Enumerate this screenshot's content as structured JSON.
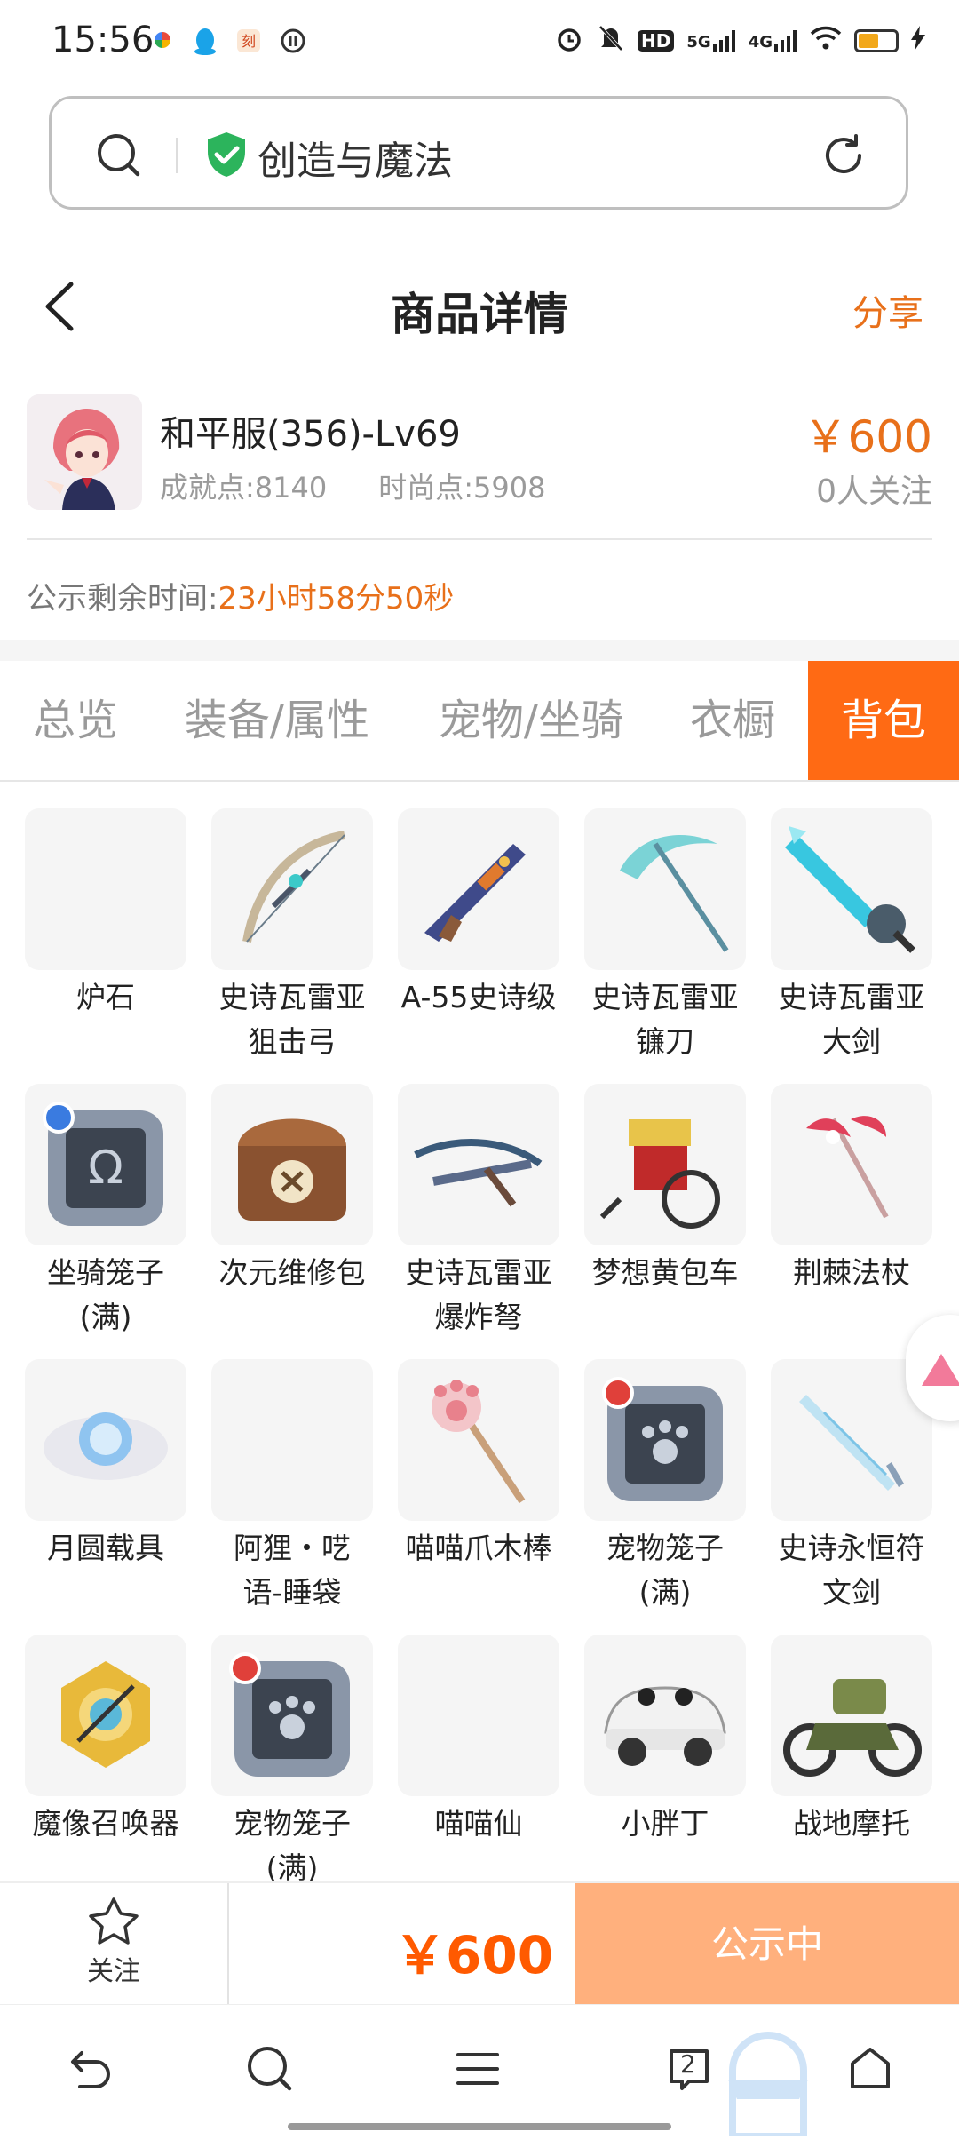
{
  "status_bar": {
    "time": "15:56",
    "signal_5g": "5G",
    "signal_4g": "4G",
    "hd": "HD"
  },
  "browser": {
    "query": "创造与魔法"
  },
  "header": {
    "title": "商品详情",
    "share": "分享"
  },
  "item": {
    "name": "和平服(356)-Lv69",
    "achievement": "成就点:8140",
    "fashion": "时尚点:5908",
    "price": "￥600",
    "watchers": "0人关注",
    "countdown_label": "公示剩余时间:",
    "countdown_value": "23小时58分50秒"
  },
  "tabs": [
    {
      "label": "总览"
    },
    {
      "label": "装备/属性"
    },
    {
      "label": "宠物/坐骑"
    },
    {
      "label": "衣橱"
    },
    {
      "label": "背包",
      "active": true
    }
  ],
  "inventory": [
    {
      "label": "炉石",
      "icon": "empty"
    },
    {
      "label": "史诗瓦雷亚狙击弓",
      "icon": "bow-icon"
    },
    {
      "label": "A-55史诗级",
      "icon": "rifle-icon"
    },
    {
      "label": "史诗瓦雷亚镰刀",
      "icon": "scythe-icon"
    },
    {
      "label": "史诗瓦雷亚大剑",
      "icon": "greatsword-icon"
    },
    {
      "label": "坐骑笼子(满)",
      "icon": "mount-cage-icon"
    },
    {
      "label": "次元维修包",
      "icon": "repair-bag-icon"
    },
    {
      "label": "史诗瓦雷亚爆炸弩",
      "icon": "crossbow-icon"
    },
    {
      "label": "梦想黄包车",
      "icon": "rickshaw-icon"
    },
    {
      "label": "荆棘法杖",
      "icon": "staff-icon"
    },
    {
      "label": "月圆载具",
      "icon": "moon-vehicle-icon"
    },
    {
      "label": "阿狸・呓语-睡袋",
      "icon": "empty"
    },
    {
      "label": "喵喵爪木棒",
      "icon": "paw-stick-icon"
    },
    {
      "label": "宠物笼子(满)",
      "icon": "pet-cage-icon"
    },
    {
      "label": "史诗永恒符文剑",
      "icon": "rune-sword-icon"
    },
    {
      "label": "魔像召唤器",
      "icon": "golem-summoner-icon"
    },
    {
      "label": "宠物笼子(满)",
      "icon": "pet-cage-icon"
    },
    {
      "label": "喵喵仙",
      "icon": "empty"
    },
    {
      "label": "小胖丁",
      "icon": "car-icon"
    },
    {
      "label": "战地摩托",
      "icon": "motorbike-icon"
    }
  ],
  "inventory_display_lines": [
    [
      "炉石"
    ],
    [
      "史诗瓦雷亚",
      "狙击弓"
    ],
    [
      "A-55史诗级"
    ],
    [
      "史诗瓦雷亚",
      "镰刀"
    ],
    [
      "史诗瓦雷亚",
      "大剑"
    ],
    [
      "坐骑笼子",
      "(满)"
    ],
    [
      "次元维修包"
    ],
    [
      "史诗瓦雷亚",
      "爆炸弩"
    ],
    [
      "梦想黄包车"
    ],
    [
      "荆棘法杖"
    ],
    [
      "月圆载具"
    ],
    [
      "阿狸・呓",
      "语-睡袋"
    ],
    [
      "喵喵爪木棒"
    ],
    [
      "宠物笼子",
      "(满)"
    ],
    [
      "史诗永恒符",
      "文剑"
    ],
    [
      "魔像召唤器"
    ],
    [
      "宠物笼子",
      "(满)"
    ],
    [
      "喵喵仙"
    ],
    [
      "小胖丁"
    ],
    [
      "战地摩托"
    ]
  ],
  "action_bar": {
    "favorite_label": "关注",
    "price": "￥600",
    "status_button": "公示中"
  },
  "sys_nav": {
    "tabs_count": "2"
  },
  "colors": {
    "accent": "#ff6a14",
    "price": "#e8701a",
    "status_button": "#ffb07d"
  }
}
